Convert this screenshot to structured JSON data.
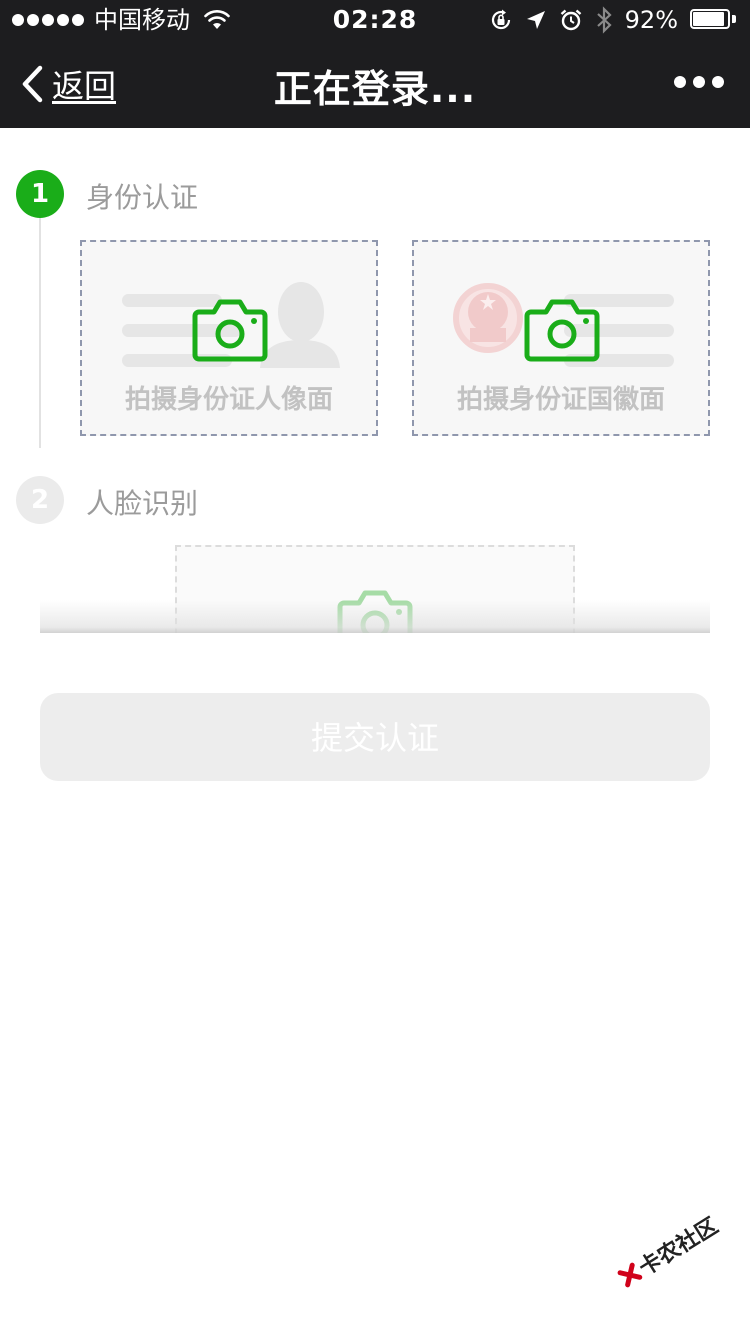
{
  "status_bar": {
    "carrier": "中国移动",
    "time": "02:28",
    "battery_percent_text": "92%",
    "battery_level": 0.92,
    "icons": [
      "wifi-icon",
      "orientation-lock-icon",
      "location-arrow-icon",
      "alarm-icon",
      "bluetooth-icon",
      "battery-icon"
    ]
  },
  "nav": {
    "back_label": "返回",
    "title": "正在登录...",
    "more_icon": "more-dots-icon"
  },
  "steps": [
    {
      "number": "1",
      "label": "身份认证",
      "active": true
    },
    {
      "number": "2",
      "label": "人脸识别",
      "active": false
    }
  ],
  "id_cards": {
    "front_caption": "拍摄身份证人像面",
    "back_caption": "拍摄身份证国徽面",
    "camera_icon": "camera-icon"
  },
  "submit": {
    "label": "提交认证",
    "enabled": false
  },
  "colors": {
    "accent_green": "#1aad19",
    "bar_background": "#1d1d1f",
    "disabled_button": "#ededed",
    "muted_text": "#9b9b9b"
  },
  "watermark": {
    "text": "卡农社区"
  }
}
